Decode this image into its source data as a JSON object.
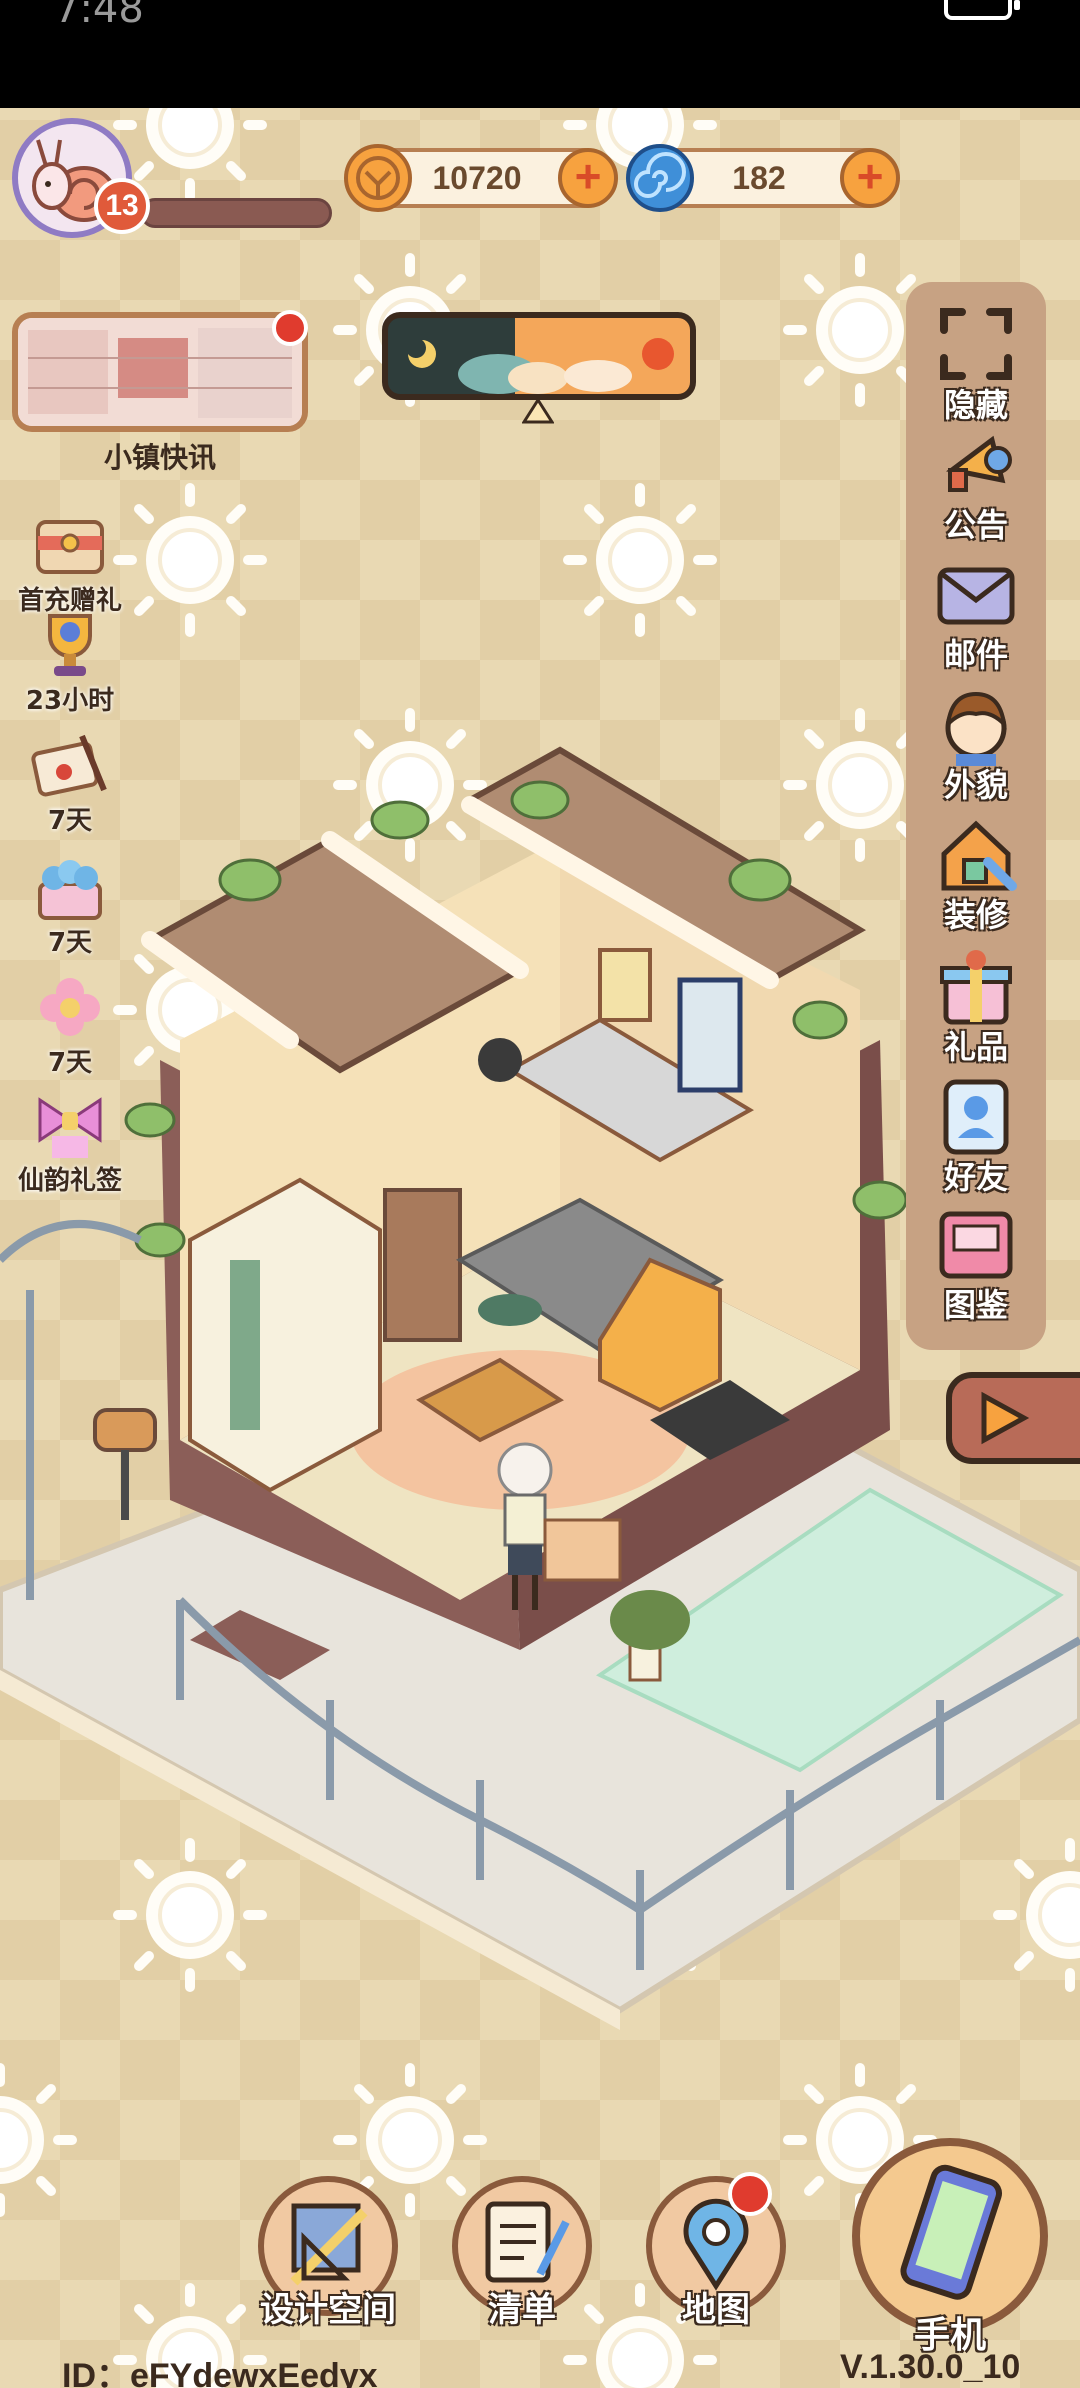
{
  "status_bar": {
    "time": "7:48"
  },
  "player": {
    "level": "13"
  },
  "currencies": [
    {
      "name": "coin",
      "value": "10720",
      "color": "#f7a23f"
    },
    {
      "name": "gem",
      "value": "182",
      "color": "#3f8fd8"
    }
  ],
  "news": {
    "label": "小镇快讯"
  },
  "left_menu": [
    {
      "label": "首充赠礼",
      "icon": "gift-box-icon"
    },
    {
      "label": "23小时",
      "icon": "trophy-icon"
    },
    {
      "label": "7天",
      "icon": "letter-icon"
    },
    {
      "label": "7天",
      "icon": "flower-box-icon"
    },
    {
      "label": "7天",
      "icon": "flower-icon"
    },
    {
      "label": "仙韵礼签",
      "icon": "bow-icon"
    }
  ],
  "right_menu": [
    {
      "label": "隐藏",
      "icon": "fullscreen-icon"
    },
    {
      "label": "公告",
      "icon": "megaphone-icon"
    },
    {
      "label": "邮件",
      "icon": "mail-icon"
    },
    {
      "label": "外貌",
      "icon": "face-icon"
    },
    {
      "label": "装修",
      "icon": "house-wrench-icon"
    },
    {
      "label": "礼品",
      "icon": "gift-icon"
    },
    {
      "label": "好友",
      "icon": "friend-icon"
    },
    {
      "label": "图鉴",
      "icon": "book-icon"
    }
  ],
  "bottom_nav": [
    {
      "label": "设计空间",
      "icon": "design-icon"
    },
    {
      "label": "清单",
      "icon": "list-icon"
    },
    {
      "label": "地图",
      "icon": "map-pin-icon"
    }
  ],
  "phone": {
    "label": "手机",
    "icon": "phone-icon"
  },
  "footer": {
    "id": "ID：eFYdewxEedyx",
    "version": "V.1.30.0_10"
  },
  "colors": {
    "background": "#e9d9b3",
    "accent": "#b77f52",
    "alert": "#e03b2e"
  }
}
